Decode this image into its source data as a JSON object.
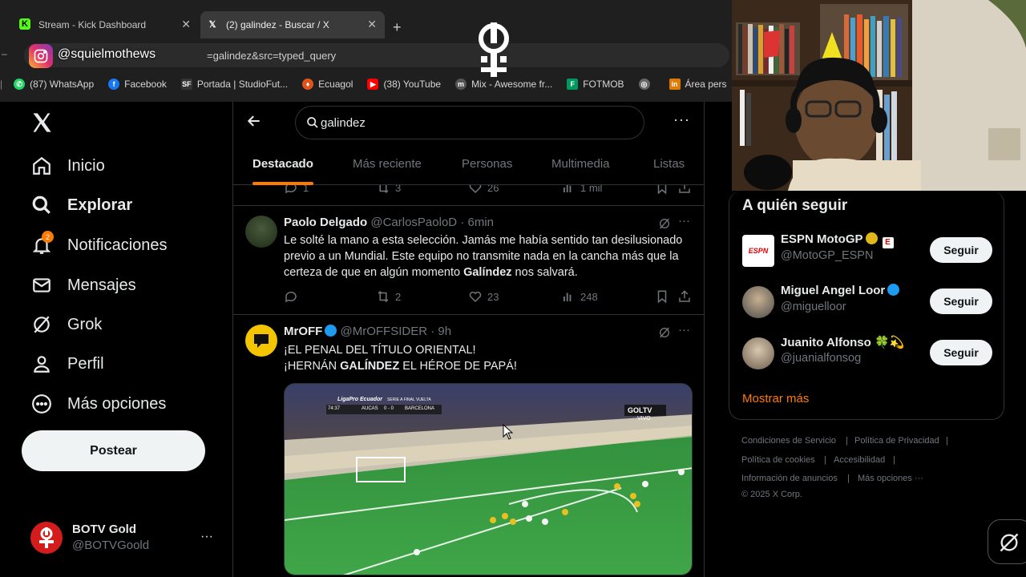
{
  "browser": {
    "tabs": [
      {
        "label": "Stream - Kick Dashboard",
        "icon": "kick-icon"
      },
      {
        "label": "(2) galindez - Buscar / X",
        "icon": "x-icon"
      }
    ],
    "new_tab": "+",
    "url": "=galindez&src=typed_query",
    "instagram_handle": "@squielmothews",
    "bookmarks": [
      "(87) WhatsApp",
      "Facebook",
      "Portada | StudioFut...",
      "Ecuagol",
      "(38) YouTube",
      "Mix - Awesome fr...",
      "FOTMOB",
      "",
      "Área pers"
    ]
  },
  "sidebar": {
    "items": [
      {
        "label": "Inicio",
        "icon": "home-icon"
      },
      {
        "label": "Explorar",
        "icon": "search-icon"
      },
      {
        "label": "Notificaciones",
        "icon": "bell-icon",
        "badge": "2"
      },
      {
        "label": "Mensajes",
        "icon": "mail-icon"
      },
      {
        "label": "Grok",
        "icon": "grok-icon"
      },
      {
        "label": "Perfil",
        "icon": "person-icon"
      },
      {
        "label": "Más opciones",
        "icon": "more-circle-icon"
      }
    ],
    "post_label": "Postear",
    "account": {
      "name": "BOTV Gold",
      "handle": "@BOTVGoold",
      "more": "···"
    }
  },
  "search": {
    "query": "galindez",
    "tabs": [
      "Destacado",
      "Más reciente",
      "Personas",
      "Multimedia",
      "Listas"
    ],
    "active_tab": "Destacado"
  },
  "prev_tweet_actions": {
    "replies": "1",
    "reposts": "3",
    "likes": "26",
    "views": "1 mil"
  },
  "tweets": [
    {
      "name": "Paolo Delgado",
      "handle": "@CarlosPaoloD",
      "time": "· 6min",
      "text_before": "Le solté la mano a esta selección. Jamás me había sentido tan desilusionado previo a un Mundial. Este equipo no transmite nada en la cancha más que la certeza de que en algún momento ",
      "text_bold": "Galíndez",
      "text_after": " nos salvará.",
      "replies": "",
      "reposts": "2",
      "likes": "23",
      "views": "248"
    },
    {
      "name": "MrOFF",
      "handle": "@MrOFFSIDER",
      "time": "· 9h",
      "line1": "¡EL PENAL DEL TÍTULO ORIENTAL!",
      "line2_before": "¡HERNÁN ",
      "line2_bold": "GALÍNDEZ",
      "line2_after": " EL HÉROE DE PAPÁ!",
      "video_overlay": {
        "league": "LigaPro Ecuador",
        "stage": "SERIE A FINAL VUELTA",
        "clock": "74:37",
        "home": "AUCAS",
        "score": "0 - 0",
        "away": "BARCELONA",
        "channel": "GOLTV",
        "live": "VIVO"
      }
    }
  ],
  "who_to_follow": {
    "title": "A quién seguir",
    "accounts": [
      {
        "name": "ESPN MotoGP",
        "handle": "@MotoGP_ESPN",
        "button": "Seguir",
        "avatar_text": "ESPN"
      },
      {
        "name": "Miguel Angel Loor",
        "handle": "@miguelloor",
        "button": "Seguir"
      },
      {
        "name": "Juanito Alfonso 🍀💫",
        "handle": "@juanialfonsog",
        "button": "Seguir"
      }
    ],
    "show_more": "Mostrar más"
  },
  "footer": {
    "links": [
      "Condiciones de Servicio",
      "Política de Privacidad",
      "Política de cookies",
      "Accesibilidad",
      "Información de anuncios",
      "Más opciones ···"
    ],
    "copyright": "© 2025 X Corp."
  },
  "colors": {
    "accent": "#ff7a00",
    "verified": "#1d9bf0",
    "gold_verified": "#e2b719",
    "bg": "#000000"
  }
}
